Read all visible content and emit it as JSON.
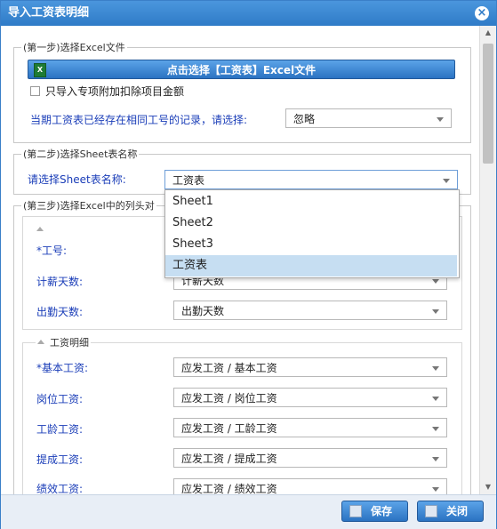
{
  "window": {
    "title": "导入工资表明细",
    "close_glyph": "×"
  },
  "step1": {
    "legend": "(第一步)选择Excel文件",
    "select_button": "点击选择【工资表】Excel文件",
    "file_icon": "excel-file-icon",
    "checkbox_label": "只导入专项附加扣除项目金额",
    "checkbox_checked": false,
    "duplicate_label": "当期工资表已经存在相同工号的记录，请选择:",
    "duplicate_value": "忽略"
  },
  "step2": {
    "legend": "(第二步)选择Sheet表名称",
    "sheet_label": "请选择Sheet表名称:",
    "sheet_value": "工资表",
    "dropdown_open": true,
    "options": [
      "Sheet1",
      "Sheet2",
      "Sheet3",
      "工资表"
    ],
    "selected_index": 3
  },
  "step3": {
    "legend": "(第三步)选择Excel中的列头对",
    "fields": [
      {
        "label": "*工号:",
        "value": ""
      },
      {
        "label": "计薪天数:",
        "value": "计薪天数"
      },
      {
        "label": "出勤天数:",
        "value": "出勤天数"
      }
    ],
    "salary_section": {
      "legend": "工资明细",
      "fields": [
        {
          "label": "*基本工资:",
          "value": "应发工资 / 基本工资"
        },
        {
          "label": "岗位工资:",
          "value": "应发工资 / 岗位工资"
        },
        {
          "label": "工龄工资:",
          "value": "应发工资 / 工龄工资"
        },
        {
          "label": "提成工资:",
          "value": "应发工资 / 提成工资"
        },
        {
          "label": "绩效工资:",
          "value": "应发工资 / 绩效工资"
        }
      ]
    }
  },
  "footer": {
    "save_label": "保存",
    "close_label": "关闭"
  },
  "colors": {
    "accent": "#2f7bc7",
    "label_blue": "#1a3db8",
    "selected_option_bg": "#c6def2"
  }
}
